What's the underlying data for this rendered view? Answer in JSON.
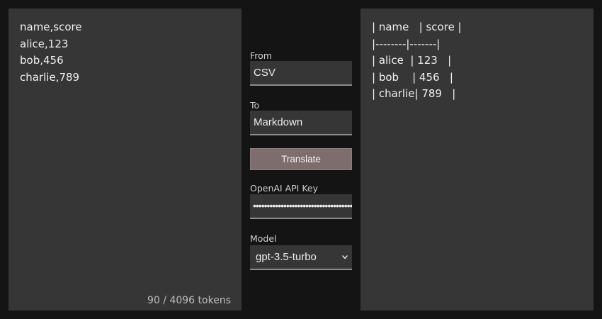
{
  "input_pane": {
    "text": "name,score\nalice,123\nbob,456\ncharlie,789",
    "token_count": "90 / 4096 tokens"
  },
  "controls": {
    "from_label": "From",
    "from_value": "CSV",
    "to_label": "To",
    "to_value": "Markdown",
    "translate_label": "Translate",
    "api_key_label": "OpenAI API Key",
    "api_key_value": "••••••••••••••••••••••••••••••••••••",
    "model_label": "Model",
    "model_value": "gpt-3.5-turbo"
  },
  "output_pane": {
    "text": "| name   | score |\n|--------|-------|\n| alice  | 123   |\n| bob    | 456   |\n| charlie| 789   |"
  },
  "icons": {
    "model_dropdown": "chevron-down-icon"
  },
  "colors": {
    "background": "#141414",
    "panel": "#363636",
    "button": "#7d6d6d"
  }
}
